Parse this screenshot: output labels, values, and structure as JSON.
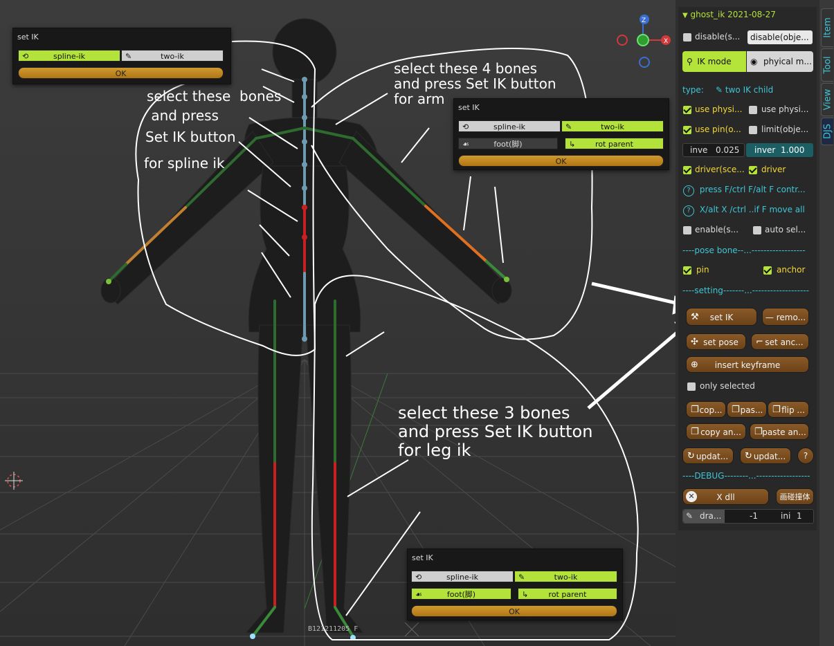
{
  "sidebar_tabs": [
    "Item",
    "Tool",
    "View",
    "DJS"
  ],
  "panel": {
    "title": "ghost_ik 2021-08-27",
    "disable_scene_label": "disable(s...",
    "disable_object_label": "disable(obje...",
    "ik_mode_label": "IK mode",
    "physical_mode_label": "phyical m...",
    "type_label": "type:",
    "type_value": "two IK child",
    "use_physics_1": "use physi...",
    "use_physics_2": "use physi...",
    "use_pin": "use pin(o...",
    "limit_object": "limit(obje...",
    "inverse_left_label": "inve",
    "inverse_left_value": "0.025",
    "inverse_right_label": "inver",
    "inverse_right_value": "1.000",
    "driver_scene": "driver(sce...",
    "driver": "driver",
    "help_1": "press F/ctrl F/alt F contr...",
    "help_2": "X/alt X /ctrl ..if F  move all",
    "enable_s": "enable(s...",
    "auto_select": "auto sel...",
    "sep_pose_bone": "----pose bone--...------------------",
    "pin_label": "pin",
    "anchor_label": "anchor",
    "sep_setting": "----setting-------...-------------------",
    "set_ik": "set IK",
    "remove": "remo...",
    "set_pose": "set pose",
    "set_anchor": "set anc...",
    "insert_keyframe": "insert keyframe",
    "only_selected": "only selected",
    "copy": "cop...",
    "paste": "pas...",
    "flip": "flip ...",
    "copy_anchor": "copy an...",
    "paste_anchor": "paste an...",
    "update_1": "updat...",
    "update_2": "updat...",
    "help_button": "?",
    "sep_debug": "----DEBUG--------...------------------",
    "x_dll": "X dll",
    "collision": "画碰撞体",
    "draw_label": "dra...",
    "draw_value": "-1",
    "ini_label": "ini",
    "ini_value": "1"
  },
  "popups": {
    "spline": {
      "title": "set IK",
      "spline_ik": "spline-ik",
      "two_ik": "two-ik",
      "ok": "OK"
    },
    "arm": {
      "title": "set IK",
      "spline_ik": "spline-ik",
      "two_ik": "two-ik",
      "foot": "foot(脚)",
      "rot_parent": "rot parent",
      "ok": "OK"
    },
    "leg": {
      "title": "set IK",
      "spline_ik": "spline-ik",
      "two_ik": "two-ik",
      "foot": "foot(脚)",
      "rot_parent": "rot parent",
      "ok": "OK"
    }
  },
  "annotations": {
    "spline_1": "select these  bones",
    "spline_2": " and press",
    "spline_3": "Set IK button",
    "spline_4": "for spline ik",
    "arm": "select these 4 bones\nand press Set IK button\nfor arm",
    "leg": "select these 3 bones\nand press Set IK button\nfor leg ik"
  },
  "viewport_label": "B121211205 F",
  "gizmo": {
    "z": "Z",
    "x": "X"
  },
  "colors": {
    "accent_green": "#b4e33a",
    "button_orange": "#c4892a",
    "cyan_text": "#3fc5d6",
    "yellow_text": "#f4d838"
  }
}
